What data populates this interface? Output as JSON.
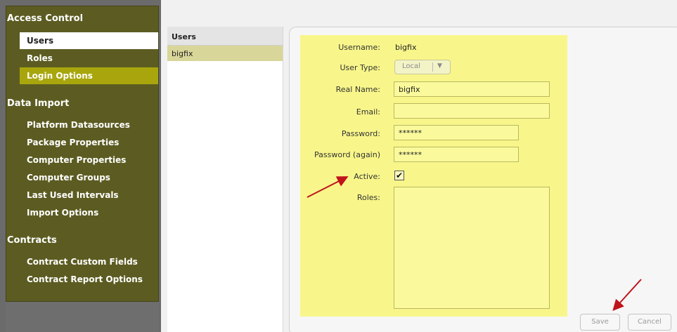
{
  "sidebar": {
    "sections": [
      {
        "title": "Access Control"
      },
      {
        "title": "Data Import"
      },
      {
        "title": "Contracts"
      }
    ],
    "items": [
      {
        "label": "Users"
      },
      {
        "label": "Roles"
      },
      {
        "label": "Login Options"
      },
      {
        "label": "Platform Datasources"
      },
      {
        "label": "Package Properties"
      },
      {
        "label": "Computer Properties"
      },
      {
        "label": "Computer Groups"
      },
      {
        "label": "Last Used Intervals"
      },
      {
        "label": "Import Options"
      },
      {
        "label": "Contract Custom Fields"
      },
      {
        "label": "Contract Report Options"
      }
    ]
  },
  "users_list": {
    "header": "Users",
    "rows": [
      "bigfix"
    ]
  },
  "form": {
    "username_label": "Username:",
    "username_value": "bigfix",
    "user_type_label": "User Type:",
    "user_type_value": "Local",
    "user_type_arrow": "▼",
    "real_name_label": "Real Name:",
    "real_name_value": "bigfix",
    "email_label": "Email:",
    "email_value": "",
    "password_label": "Password:",
    "password_value": "******",
    "password_again_label": "Password (again)",
    "password_again_value": "******",
    "active_label": "Active:",
    "active_checked": "✔",
    "roles_label": "Roles:"
  },
  "buttons": {
    "save": "Save",
    "cancel": "Cancel"
  },
  "colors": {
    "sidebar_bg": "#5c5c22",
    "login_highlight": "#a8a60c",
    "form_bg": "#f8f68a",
    "selected_row": "#d9d69a",
    "annotation_arrow": "#c0141b"
  }
}
